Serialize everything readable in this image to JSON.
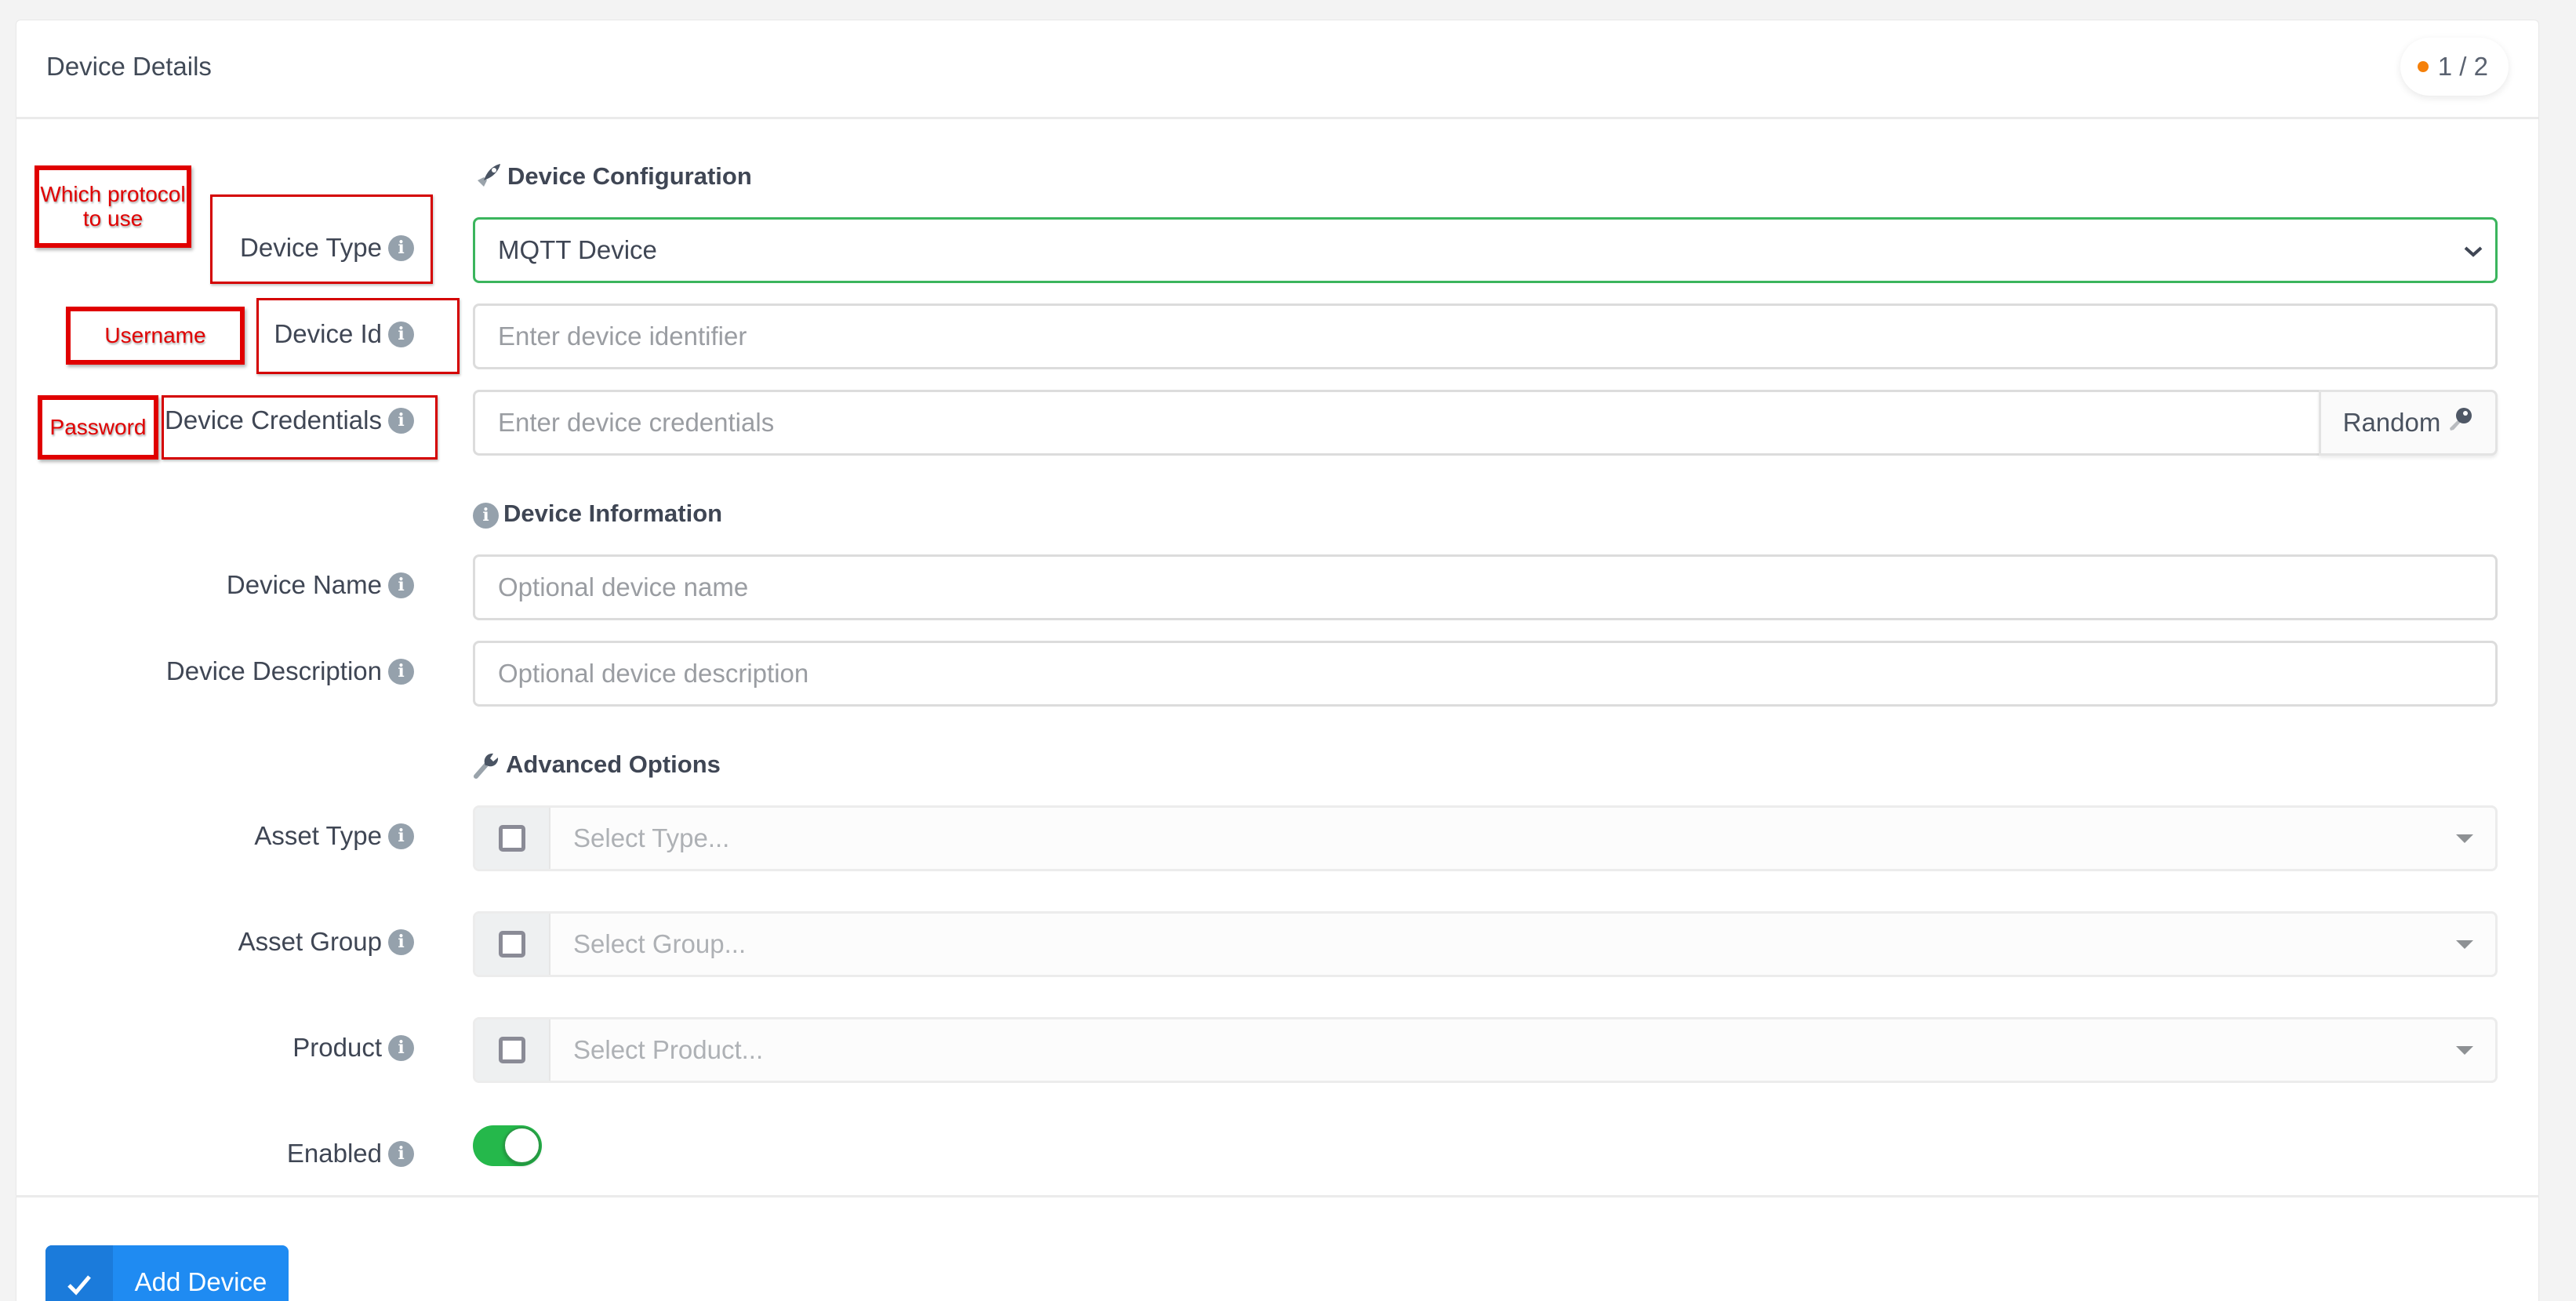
{
  "card": {
    "title": "Device Details",
    "step_badge": {
      "text": "1 / 2",
      "dot_color": "#f5800a"
    }
  },
  "sections": {
    "configuration": {
      "title": "Device Configuration",
      "icon": "rocket-icon"
    },
    "information": {
      "title": "Device Information",
      "icon": "info-circle-icon"
    },
    "advanced": {
      "title": "Advanced Options",
      "icon": "wrench-icon"
    }
  },
  "fields": {
    "device_type": {
      "label": "Device Type",
      "value": "MQTT Device"
    },
    "device_id": {
      "label": "Device Id",
      "value": "",
      "placeholder": "Enter device identifier"
    },
    "device_credentials": {
      "label": "Device Credentials",
      "value": "",
      "placeholder": "Enter device credentials",
      "random_button": "Random"
    },
    "device_name": {
      "label": "Device Name",
      "value": "",
      "placeholder": "Optional device name"
    },
    "device_description": {
      "label": "Device Description",
      "value": "",
      "placeholder": "Optional device description"
    },
    "asset_type": {
      "label": "Asset Type",
      "placeholder": "Select Type...",
      "checked": false
    },
    "asset_group": {
      "label": "Asset Group",
      "placeholder": "Select Group...",
      "checked": false
    },
    "product": {
      "label": "Product",
      "placeholder": "Select Product...",
      "checked": false
    },
    "enabled": {
      "label": "Enabled",
      "on": true
    }
  },
  "info_icon_glyph": "i",
  "footer": {
    "submit_label": "Add Device"
  },
  "annotations": {
    "protocol": "Which protocol to use",
    "username": "Username",
    "password": "Password"
  },
  "colors": {
    "accent_blue": "#1f8bf2",
    "success_green": "#25b84b",
    "select_focus_border": "#3bb55d",
    "annotation_red": "#e00000"
  }
}
